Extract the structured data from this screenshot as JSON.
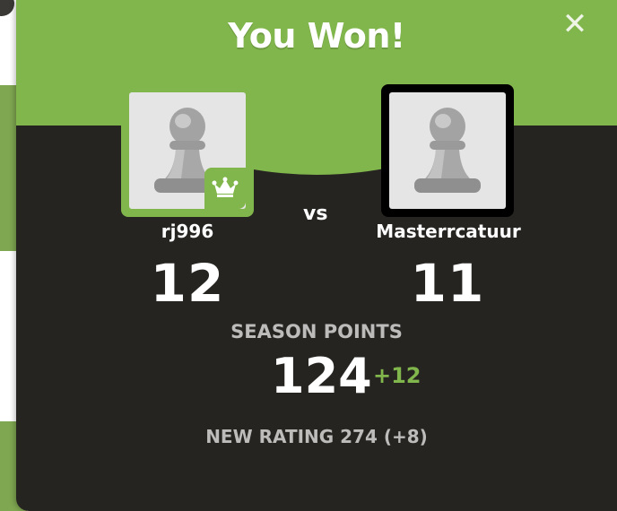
{
  "modal": {
    "title": "You Won!",
    "close_icon": "close-icon",
    "vs_label": "vs",
    "players": [
      {
        "name": "rj996",
        "score": "12",
        "avatar": "pawn-icon",
        "badge": "crown-icon"
      },
      {
        "name": "Masterrcatuur",
        "score": "11",
        "avatar": "pawn-icon"
      }
    ],
    "season": {
      "label": "SEASON POINTS",
      "value": "124",
      "delta": "+12"
    },
    "rating_text": "NEW RATING 274 (+8)"
  },
  "colors": {
    "accent_green": "#81b64c",
    "panel_dark": "#262421",
    "muted_text": "#bdbcbb"
  }
}
